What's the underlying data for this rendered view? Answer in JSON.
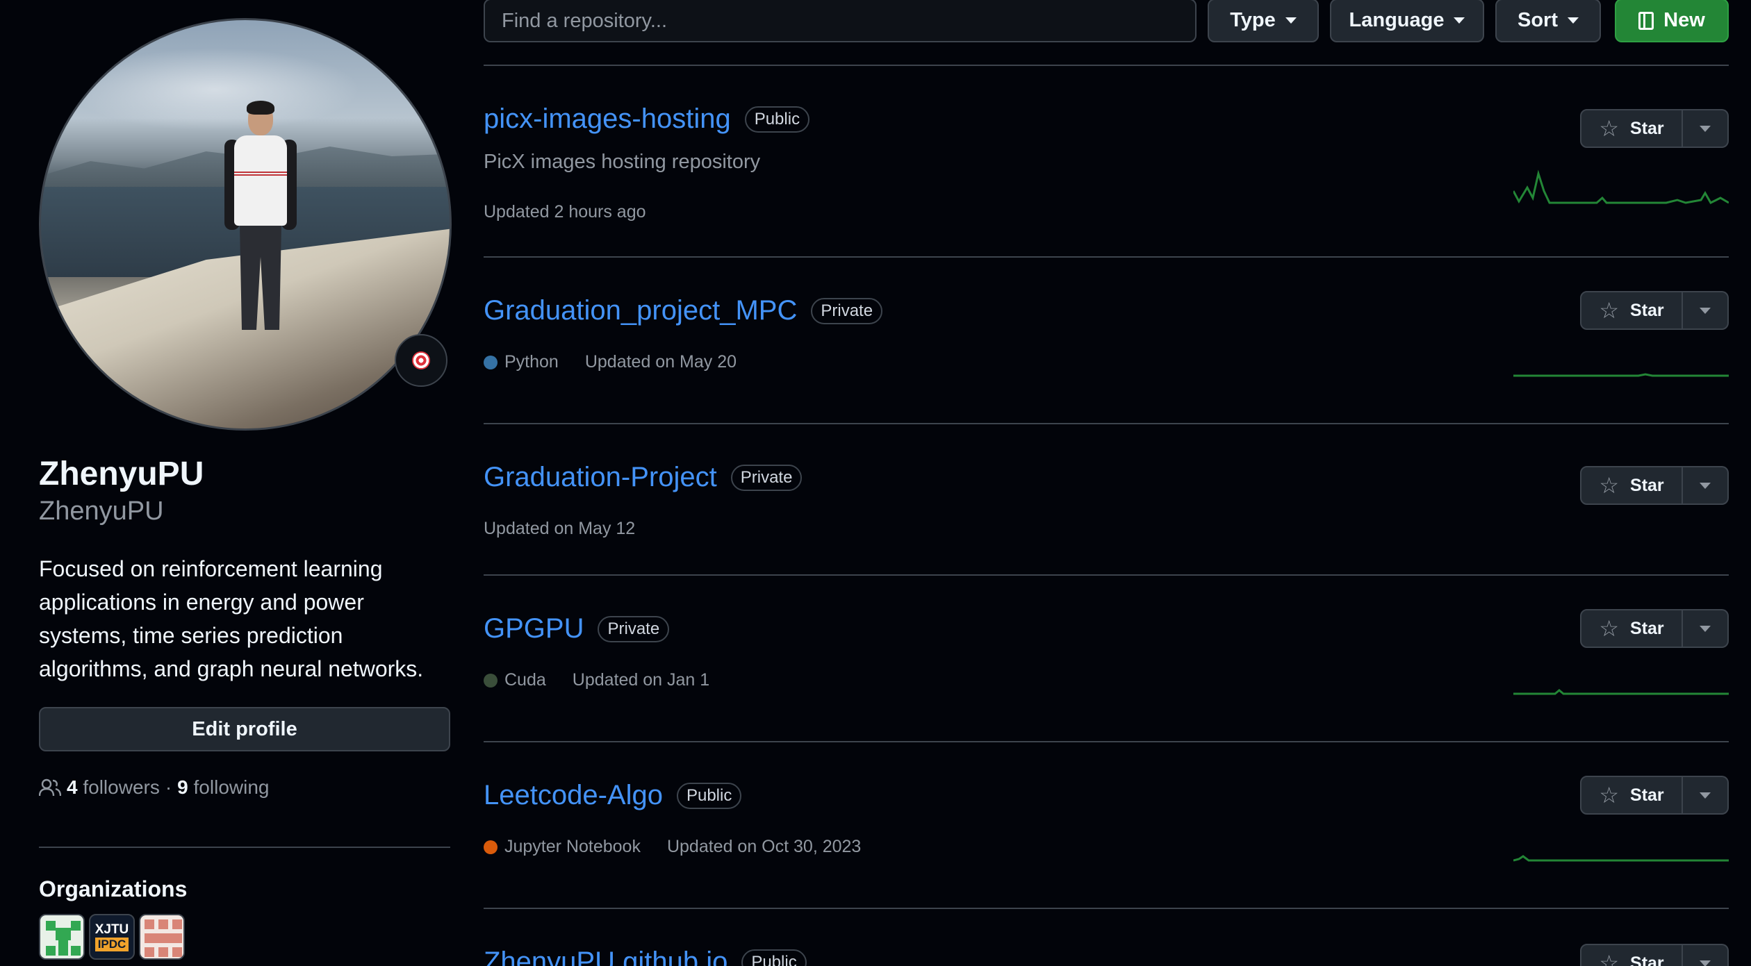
{
  "profile": {
    "name": "ZhenyuPU",
    "login": "ZhenyuPU",
    "bio": "Focused on reinforcement learning applications in energy and power systems, time series prediction algorithms, and graph neural networks.",
    "edit_label": "Edit profile",
    "followers_count": "4",
    "followers_label": "followers",
    "separator": "·",
    "following_count": "9",
    "following_label": "following",
    "orgs_title": "Organizations",
    "org2_line1": "XJTU",
    "org2_line2": "IPDC"
  },
  "toolbar": {
    "search_placeholder": "Find a repository...",
    "type_label": "Type",
    "language_label": "Language",
    "sort_label": "Sort",
    "new_label": "New"
  },
  "repos": [
    {
      "name": "picx-images-hosting",
      "visibility": "Public",
      "description": "PicX images hosting repository",
      "language": "",
      "updated": "Updated 2 hours ago",
      "star_label": "Star"
    },
    {
      "name": "Graduation_project_MPC",
      "visibility": "Private",
      "description": "",
      "language": "Python",
      "language_color": "#3572A5",
      "updated": "Updated on May 20",
      "star_label": "Star"
    },
    {
      "name": "Graduation-Project",
      "visibility": "Private",
      "description": "",
      "language": "",
      "updated": "Updated on May 12",
      "star_label": "Star"
    },
    {
      "name": "GPGPU",
      "visibility": "Private",
      "description": "",
      "language": "Cuda",
      "language_color": "#3A4E3A",
      "updated": "Updated on Jan 1",
      "star_label": "Star"
    },
    {
      "name": "Leetcode-Algo",
      "visibility": "Public",
      "description": "",
      "language": "Jupyter Notebook",
      "language_color": "#DA5B0B",
      "updated": "Updated on Oct 30, 2023",
      "star_label": "Star"
    },
    {
      "name": "ZhenyuPU.github.io",
      "visibility": "Public",
      "star_label": "Star"
    }
  ],
  "colors": {
    "link": "#4493f8",
    "sparkline": "#238636",
    "new_button": "#238636"
  }
}
